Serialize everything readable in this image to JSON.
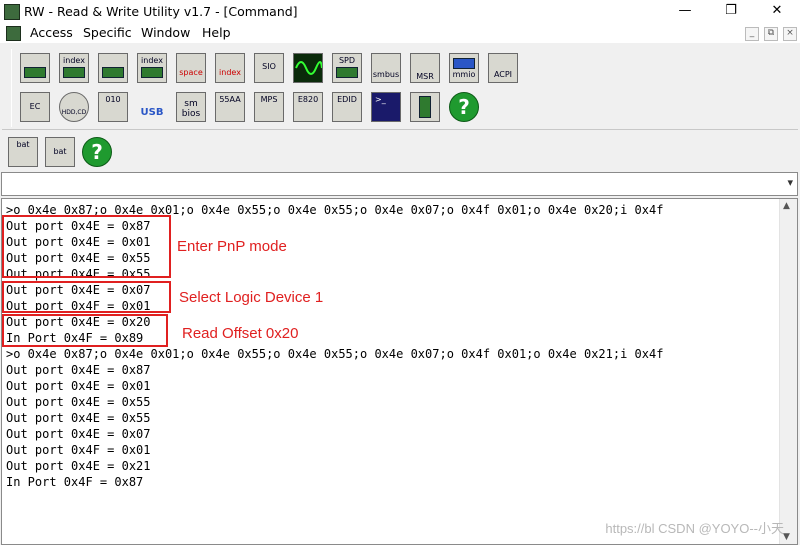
{
  "window": {
    "title": "RW - Read & Write Utility v1.7 - [Command]",
    "controls": [
      "—",
      "❐",
      "✕"
    ]
  },
  "menu": {
    "items": [
      "Access",
      "Specific",
      "Window",
      "Help"
    ],
    "mdi_controls": [
      "_",
      "⧉",
      "×"
    ]
  },
  "toolbar": {
    "row1": [
      "",
      "index",
      "",
      "index",
      "",
      "",
      "SIO",
      "",
      "SPD",
      "smbus",
      "MSR",
      "mmio",
      "ACPI"
    ],
    "row1_icons": [
      "pci-icon",
      "pci-index-icon",
      "memory-icon",
      "memory-index-icon",
      "io-space-icon",
      "io-index-icon",
      "sio-icon",
      "waveform-icon",
      "spd-icon",
      "smbus-icon",
      "msr-icon",
      "mmio-icon",
      "acpi-icon"
    ],
    "row2": [
      "EC",
      "HDD,CD",
      "010",
      "USB",
      "sm bios",
      "55AA",
      "MPS",
      "E820",
      "EDID",
      "",
      "",
      "?"
    ],
    "row2_icons": [
      "ec-icon",
      "hdd-cd-icon",
      "binary-file-icon",
      "usb-icon",
      "smbios-icon",
      "rom-55aa-icon",
      "mps-icon",
      "e820-icon",
      "edid-icon",
      "console-icon",
      "pci-card-icon",
      "help-icon"
    ],
    "row3": [
      "bat",
      "bat",
      "?"
    ],
    "row3_icons": [
      "save-batch-icon",
      "batch-file-icon",
      "help-icon"
    ]
  },
  "command_input": {
    "value": ""
  },
  "console": {
    "lines": [
      ">o 0x4e 0x87;o 0x4e 0x01;o 0x4e 0x55;o 0x4e 0x55;o 0x4e 0x07;o 0x4f 0x01;o 0x4e 0x20;i 0x4f",
      "Out port 0x4E = 0x87",
      "Out port 0x4E = 0x01",
      "Out port 0x4E = 0x55",
      "Out port 0x4E = 0x55",
      "Out port 0x4E = 0x07",
      "Out port 0x4F = 0x01",
      "Out port 0x4E = 0x20",
      "In Port 0x4F = 0x89",
      ">o 0x4e 0x87;o 0x4e 0x01;o 0x4e 0x55;o 0x4e 0x55;o 0x4e 0x07;o 0x4f 0x01;o 0x4e 0x21;i 0x4f",
      "Out port 0x4E = 0x87",
      "Out port 0x4E = 0x01",
      "Out port 0x4E = 0x55",
      "Out port 0x4E = 0x55",
      "Out port 0x4E = 0x07",
      "Out port 0x4F = 0x01",
      "Out port 0x4E = 0x21",
      "In Port 0x4F = 0x87"
    ]
  },
  "annotations": {
    "note1": "Enter PnP mode",
    "note2": "Select Logic Device 1",
    "note3": "Read Offset 0x20",
    "color": "#e02020"
  },
  "watermark": "https://bl  CSDN @YOYO--小天"
}
